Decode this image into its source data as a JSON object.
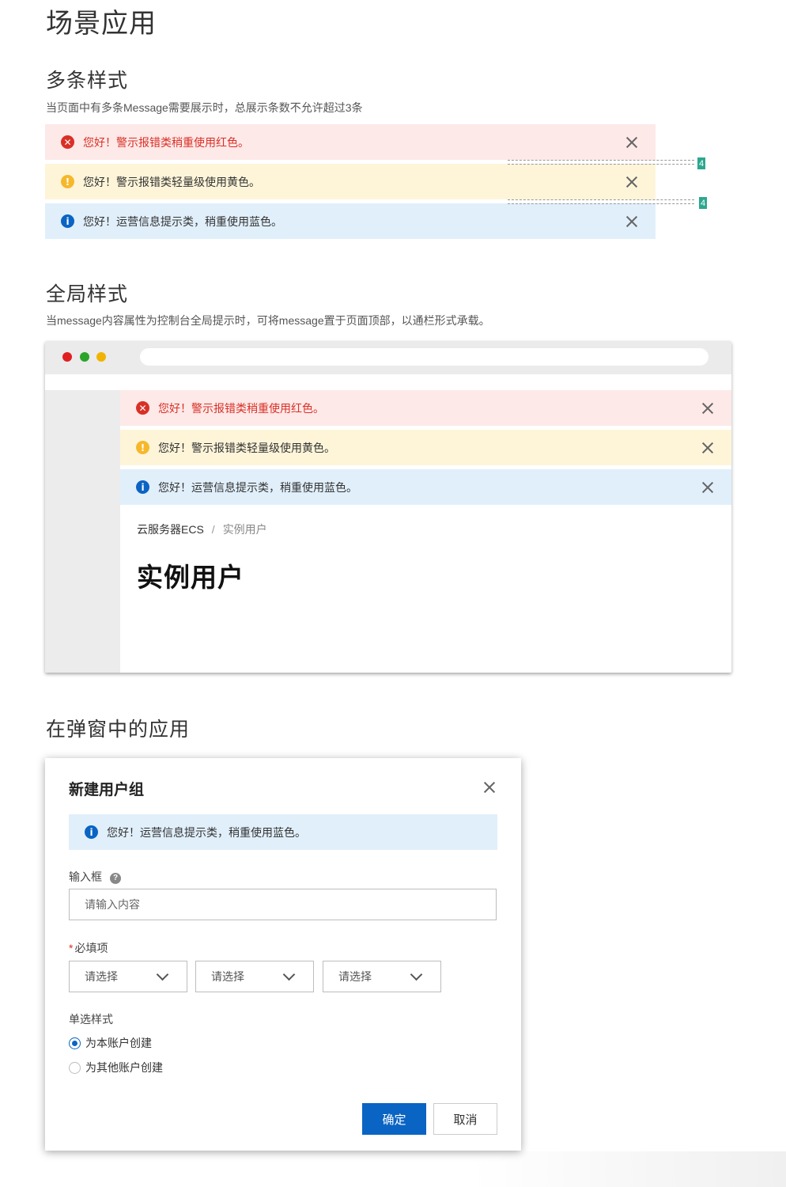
{
  "page": {
    "title": "场景应用",
    "sections": {
      "multi": {
        "heading": "多条样式",
        "description": "当页面中有多条Message需要展示时，总展示条数不允许超过3条",
        "spacing_marks": [
          "4",
          "4"
        ]
      },
      "global": {
        "heading": "全局样式",
        "description": "当message内容属性为控制台全局提示时，可将message置于页面顶部，以通栏形式承载。"
      },
      "dialog": {
        "heading": "在弹窗中的应用"
      }
    }
  },
  "messages": [
    {
      "type": "error",
      "icon": "error-icon",
      "glyph": "✕",
      "text": "您好！警示报错类稍重使用红色。"
    },
    {
      "type": "warning",
      "icon": "warning-icon",
      "glyph": "!",
      "text": "您好！警示报错类轻量级使用黄色。"
    },
    {
      "type": "info",
      "icon": "info-icon",
      "glyph": "i",
      "text": "您好！运营信息提示类，稍重使用蓝色。"
    }
  ],
  "browser": {
    "traffic_lights": [
      "#e02020",
      "#2aa52a",
      "#f0b400"
    ],
    "breadcrumb": {
      "root": "云服务器ECS",
      "separator": "/",
      "current": "实例用户"
    },
    "page_title": "实例用户"
  },
  "dialog": {
    "title": "新建用户组",
    "message": {
      "type": "info",
      "icon": "info-icon",
      "glyph": "i",
      "text": "您好！运营信息提示类，稍重使用蓝色。"
    },
    "input_field": {
      "label": "输入框",
      "help_glyph": "?",
      "placeholder": "请输入内容"
    },
    "required_field": {
      "asterisk": "*",
      "label": "必填项",
      "selects": [
        "请选择",
        "请选择",
        "请选择"
      ]
    },
    "radio_group": {
      "label": "单选样式",
      "options": [
        {
          "label": "为本账户创建",
          "checked": true
        },
        {
          "label": "为其他账户创建",
          "checked": false
        }
      ]
    },
    "buttons": {
      "confirm": "确定",
      "cancel": "取消"
    }
  },
  "colors": {
    "error_bg": "#fde9e8",
    "warning_bg": "#fef5d9",
    "info_bg": "#e1effb",
    "error": "#d93026",
    "warning": "#f6b82b",
    "primary": "#0a64c3",
    "spacing_tag": "#2ba88e"
  }
}
